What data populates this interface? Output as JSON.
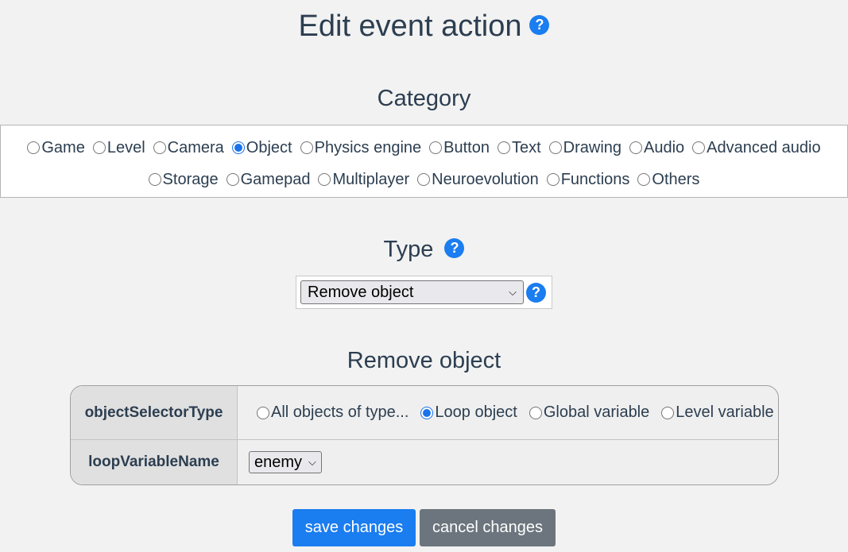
{
  "title": "Edit event action",
  "help_glyph": "?",
  "category": {
    "heading": "Category",
    "row1": [
      {
        "label": "Game",
        "checked": false
      },
      {
        "label": "Level",
        "checked": false
      },
      {
        "label": "Camera",
        "checked": false
      },
      {
        "label": "Object",
        "checked": true
      },
      {
        "label": "Physics engine",
        "checked": false
      },
      {
        "label": "Button",
        "checked": false
      },
      {
        "label": "Text",
        "checked": false
      },
      {
        "label": "Drawing",
        "checked": false
      },
      {
        "label": "Audio",
        "checked": false
      },
      {
        "label": "Advanced audio",
        "checked": false
      }
    ],
    "row2": [
      {
        "label": "Storage",
        "checked": false
      },
      {
        "label": "Gamepad",
        "checked": false
      },
      {
        "label": "Multiplayer",
        "checked": false
      },
      {
        "label": "Neuroevolution",
        "checked": false
      },
      {
        "label": "Functions",
        "checked": false
      },
      {
        "label": "Others",
        "checked": false
      }
    ]
  },
  "type": {
    "heading": "Type",
    "selected": "Remove object"
  },
  "params": {
    "heading": "Remove object",
    "objectSelectorType": {
      "label": "objectSelectorType",
      "options": [
        {
          "label": "All objects of type...",
          "checked": false
        },
        {
          "label": "Loop object",
          "checked": true
        },
        {
          "label": "Global variable",
          "checked": false
        },
        {
          "label": "Level variable",
          "checked": false
        }
      ]
    },
    "loopVariableName": {
      "label": "loopVariableName",
      "selected": "enemy"
    }
  },
  "buttons": {
    "save": "save changes",
    "cancel": "cancel changes"
  },
  "colors": {
    "accent": "#1a7df0",
    "secondary": "#6c757d",
    "text": "#2c3e50"
  }
}
